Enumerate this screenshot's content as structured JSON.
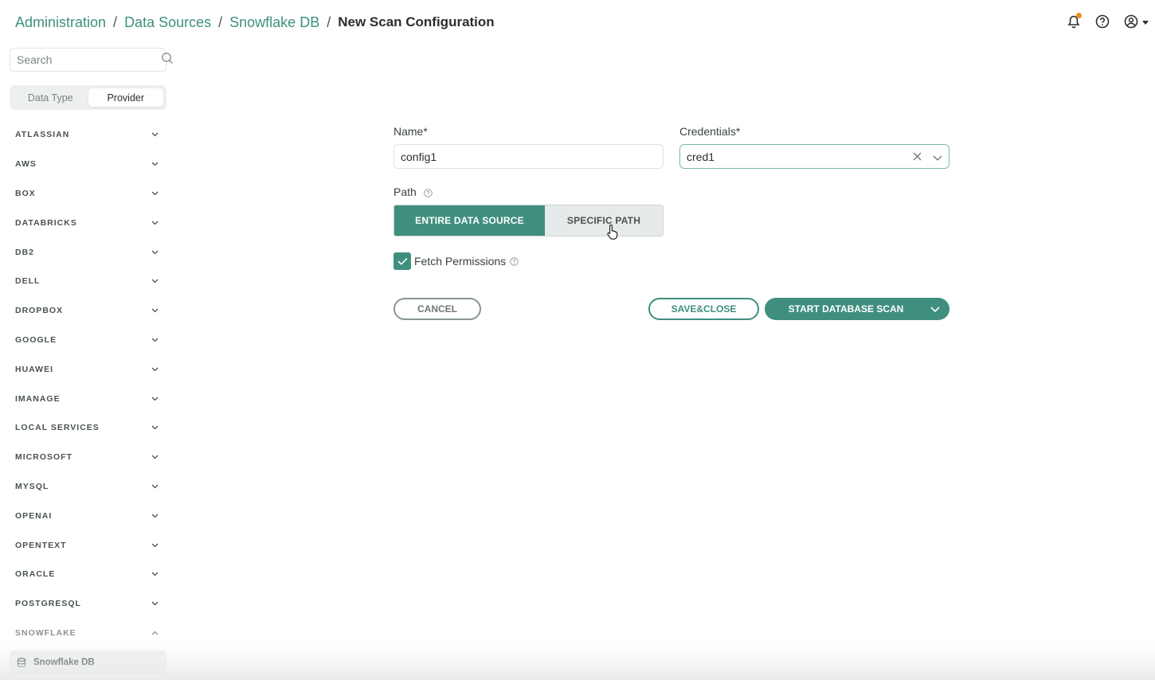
{
  "breadcrumb": {
    "items": [
      "Administration",
      "Data Sources",
      "Snowflake DB"
    ],
    "separator": "/",
    "current": "New Scan Configuration"
  },
  "header": {
    "icons": [
      "bell-icon",
      "help-icon",
      "user-icon",
      "caret-down-icon"
    ],
    "notification_color": "#f08a24"
  },
  "sidebar": {
    "search_placeholder": "Search",
    "toggle": {
      "options": [
        "Data Type",
        "Provider"
      ],
      "selected": "Provider"
    },
    "providers": [
      {
        "label": "ATLASSIAN",
        "expanded": false
      },
      {
        "label": "AWS",
        "expanded": false
      },
      {
        "label": "BOX",
        "expanded": false
      },
      {
        "label": "DATABRICKS",
        "expanded": false
      },
      {
        "label": "DB2",
        "expanded": false
      },
      {
        "label": "DELL",
        "expanded": false
      },
      {
        "label": "DROPBOX",
        "expanded": false
      },
      {
        "label": "GOOGLE",
        "expanded": false
      },
      {
        "label": "HUAWEI",
        "expanded": false
      },
      {
        "label": "IMANAGE",
        "expanded": false
      },
      {
        "label": "LOCAL SERVICES",
        "expanded": false
      },
      {
        "label": "MICROSOFT",
        "expanded": false
      },
      {
        "label": "MYSQL",
        "expanded": false
      },
      {
        "label": "OPENAI",
        "expanded": false
      },
      {
        "label": "OPENTEXT",
        "expanded": false
      },
      {
        "label": "ORACLE",
        "expanded": false
      },
      {
        "label": "POSTGRESQL",
        "expanded": false
      },
      {
        "label": "SNOWFLAKE",
        "expanded": true
      }
    ],
    "sub_item": "Snowflake DB"
  },
  "form": {
    "name_label": "Name*",
    "name_value": "config1",
    "credentials_label": "Credentials*",
    "credentials_value": "cred1",
    "path_label": "Path",
    "path_options": [
      "ENTIRE DATA SOURCE",
      "SPECIFIC PATH"
    ],
    "path_selected": "ENTIRE DATA SOURCE",
    "fetch_permissions_label": "Fetch Permissions",
    "fetch_permissions_checked": true
  },
  "actions": {
    "cancel": "CANCEL",
    "save_close": "SAVE&CLOSE",
    "start_scan": "START DATABASE SCAN"
  },
  "colors": {
    "accent": "#3f8f7f",
    "breadcrumb_link": "#3f8f80"
  }
}
